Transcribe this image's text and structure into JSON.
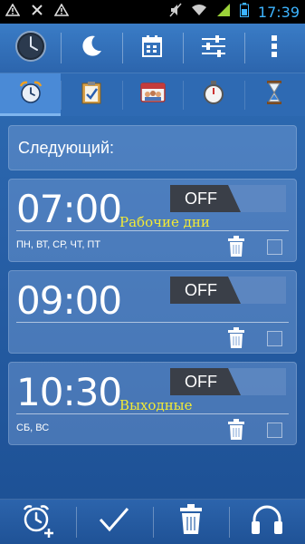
{
  "status_bar": {
    "time": "17:39",
    "icons": [
      "warning-icon",
      "close-icon",
      "warning-icon",
      "mute-icon",
      "wifi-icon",
      "signal-icon",
      "battery-icon"
    ]
  },
  "toolbar": {
    "buttons": [
      "clock-icon",
      "night-mode-icon",
      "calendar-icon",
      "settings-sliders-icon",
      "more-icon"
    ]
  },
  "tabs": [
    {
      "icon": "alarm-clock-icon",
      "active": true
    },
    {
      "icon": "clipboard-icon",
      "active": false
    },
    {
      "icon": "calendar-people-icon",
      "active": false
    },
    {
      "icon": "stopwatch-icon",
      "active": false
    },
    {
      "icon": "hourglass-icon",
      "active": false
    }
  ],
  "next_label": "Следующий:",
  "alarms": [
    {
      "time": "07:00",
      "name": "Рабочие дни",
      "days": "ПН, ВТ, СР, ЧТ, ПТ",
      "state": "OFF"
    },
    {
      "time": "09:00",
      "name": "",
      "days": "",
      "state": "OFF"
    },
    {
      "time": "10:30",
      "name": "Выходные",
      "days": "СБ, ВС",
      "state": "OFF"
    }
  ],
  "bottom_bar": {
    "buttons": [
      "add-alarm-icon",
      "checkmark-icon",
      "trash-icon",
      "headphones-icon"
    ]
  },
  "colors": {
    "accent_text": "#f2ea35",
    "status_time": "#3db4ff",
    "toggle_off": "#3a3f48"
  }
}
